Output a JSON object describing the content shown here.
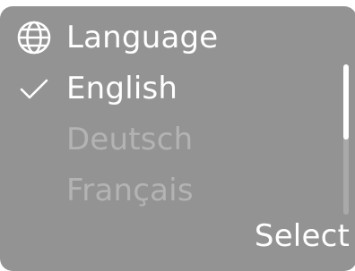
{
  "menu": {
    "title": "Language",
    "title_icon": "globe-icon",
    "options": [
      {
        "label": "English",
        "selected": true,
        "enabled": true,
        "icon": "checkmark-icon"
      },
      {
        "label": "Deutsch",
        "selected": false,
        "enabled": false
      },
      {
        "label": "Français",
        "selected": false,
        "enabled": false
      }
    ],
    "action_label": "Select",
    "scroll_position": 0,
    "scroll_visible_fraction": 0.5
  },
  "colors": {
    "panel": "#939393",
    "text": "#ffffff",
    "muted_text": "#b3b3b3",
    "scroll_track": "#a9a9a9"
  }
}
